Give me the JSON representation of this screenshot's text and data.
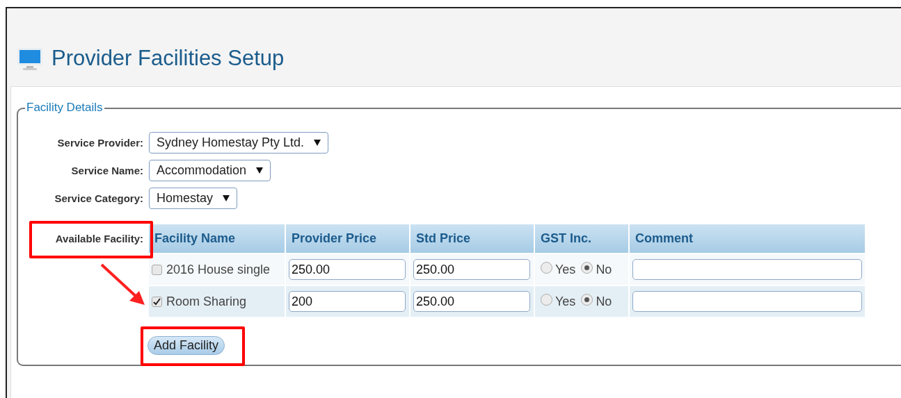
{
  "page": {
    "title": "Provider Facilities Setup"
  },
  "fieldset": {
    "legend": "Facility Details"
  },
  "fields": [
    {
      "label": "Service Provider:",
      "value": "Sydney Homestay Pty Ltd."
    },
    {
      "label": "Service Name:",
      "value": "Accommodation"
    },
    {
      "label": "Service Category:",
      "value": "Homestay"
    }
  ],
  "facility_label": "Available Facility:",
  "table": {
    "columns": [
      "Facility Name",
      "Provider Price",
      "Std Price",
      "GST Inc.",
      "Comment"
    ],
    "rows": [
      {
        "checked": false,
        "name": "2016 House single",
        "provider_price": "250.00",
        "std_price": "250.00",
        "gst": [
          {
            "label": "Yes",
            "selected": false
          },
          {
            "label": "No",
            "selected": true
          }
        ]
      },
      {
        "checked": true,
        "name": "Room Sharing",
        "provider_price": "200",
        "std_price": "250.00",
        "gst": [
          {
            "label": "Yes",
            "selected": false
          },
          {
            "label": "No",
            "selected": true
          }
        ]
      }
    ]
  },
  "button": "Add Facility"
}
